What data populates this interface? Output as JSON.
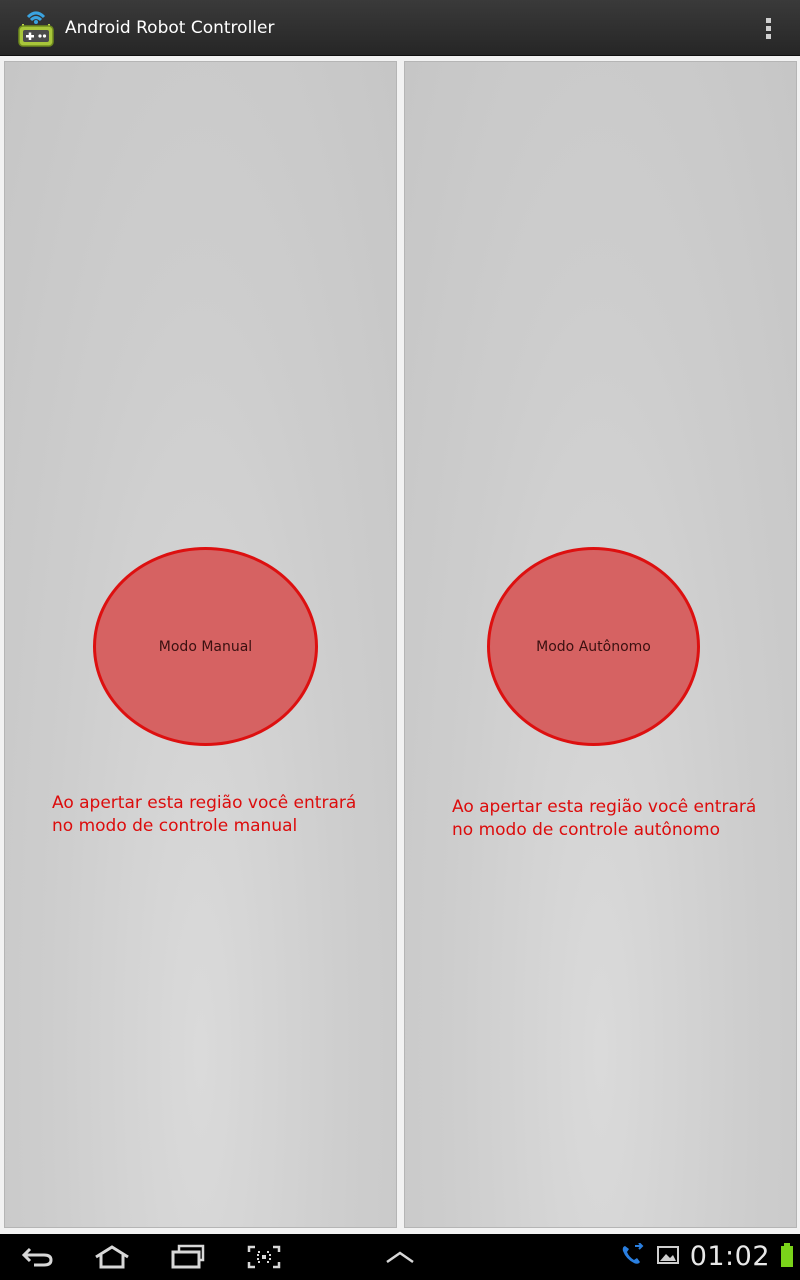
{
  "app": {
    "title": "Android Robot Controller",
    "icon": "robot-gamepad-icon",
    "menu_icon": "overflow-menu-icon"
  },
  "panels": [
    {
      "id": "manual",
      "button_label": "Modo Manual",
      "hint_line1": "Ao apertar esta região você entrará",
      "hint_line2": "no modo de controle manual"
    },
    {
      "id": "autonomous",
      "button_label": "Modo Autônomo",
      "hint_line1": "Ao apertar esta região você entrará",
      "hint_line2": "no modo de controle autônomo"
    }
  ],
  "nav_bar": {
    "buttons": [
      "back-icon",
      "home-icon",
      "recent-apps-icon",
      "screen-capture-icon",
      "expand-up-icon"
    ],
    "status_icons": [
      "phone-call-icon",
      "gallery-icon",
      "battery-icon"
    ],
    "clock": "01:02"
  },
  "colors": {
    "accent_red": "#dd1010",
    "button_fill": "#d66262",
    "hint_text": "#dc0c0c",
    "action_bar": "#2e2e2e",
    "battery": "#7ad31a",
    "call_icon": "#2a7fe0"
  }
}
